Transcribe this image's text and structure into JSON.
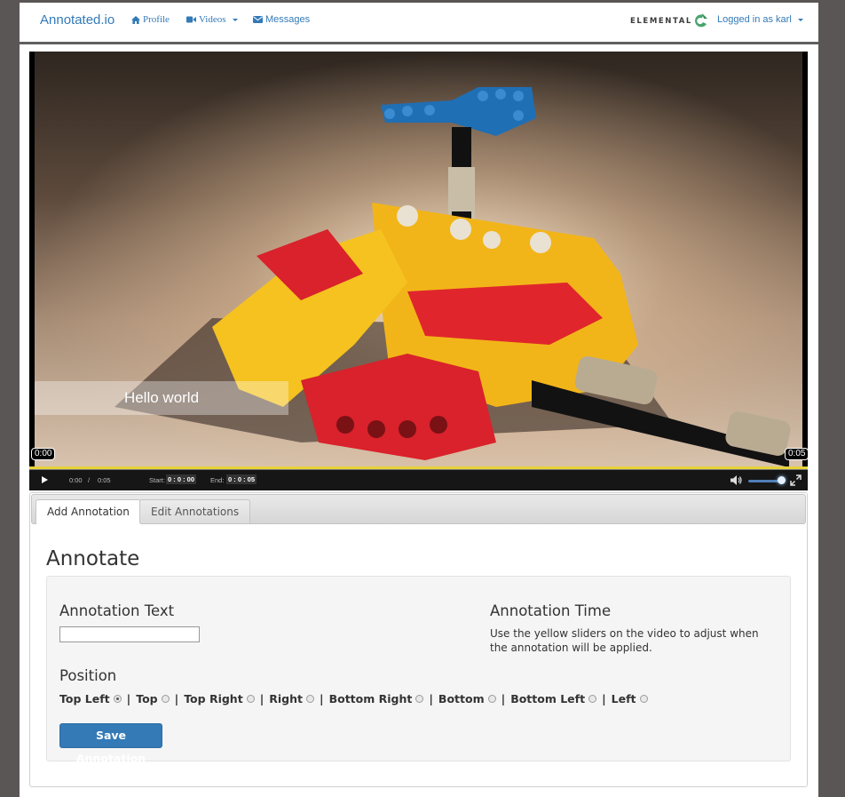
{
  "navbar": {
    "brand": "Annotated.io",
    "profile_label": "Profile",
    "videos_label": "Videos",
    "messages_label": "Messages",
    "logo_text": "ELEMENTAL",
    "user_label": "Logged in as karl",
    "accent_color": "#337ab7"
  },
  "video": {
    "overlay_text": "Hello world",
    "start_marker": "0:00",
    "end_marker": "0:05",
    "current_time": "0:00",
    "time_separator": "/",
    "duration": "0:05",
    "start_label": "Start:",
    "start_value": "0 : 0 : 00",
    "end_label": "End:",
    "end_value": "0 : 0 : 05",
    "slider_color": "#e8d23a"
  },
  "tabs": [
    {
      "label": "Add Annotation",
      "active": true
    },
    {
      "label": "Edit Annotations",
      "active": false
    }
  ],
  "form": {
    "heading": "Annotate",
    "text_label": "Annotation Text",
    "text_value": "",
    "time_label": "Annotation Time",
    "time_help": "Use the yellow sliders on the video to adjust when the annotation will be applied.",
    "position_label": "Position",
    "separator": "|",
    "positions": [
      {
        "label": "Top Left",
        "checked": true
      },
      {
        "label": "Top",
        "checked": false
      },
      {
        "label": "Top Right",
        "checked": false
      },
      {
        "label": "Right",
        "checked": false
      },
      {
        "label": "Bottom Right",
        "checked": false
      },
      {
        "label": "Bottom",
        "checked": false
      },
      {
        "label": "Bottom Left",
        "checked": false
      },
      {
        "label": "Left",
        "checked": false
      }
    ],
    "save_label": "Save Annotation"
  }
}
